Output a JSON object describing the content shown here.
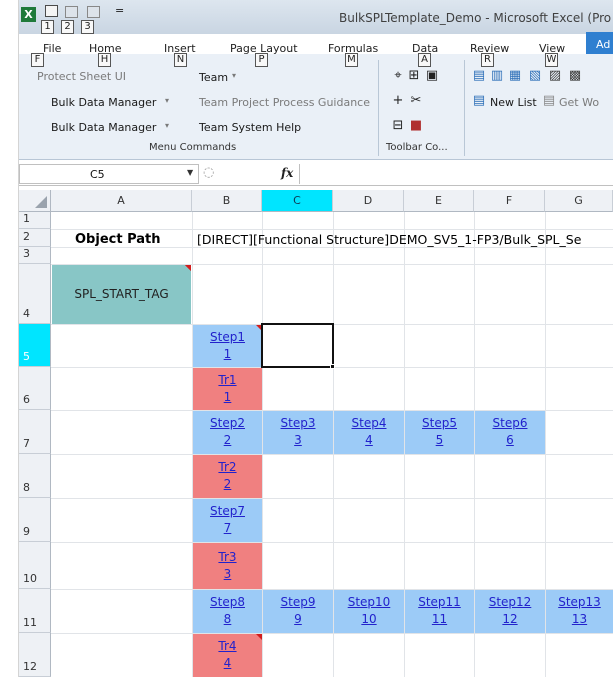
{
  "window": {
    "title": "BulkSPLTemplate_Demo  -  Microsoft Excel (Pro",
    "app_icon_glyph": "X",
    "quick_access": {
      "qat_dropdown": "="
    }
  },
  "ribbon_tabs": [
    {
      "label": "File",
      "keytip": "F"
    },
    {
      "label": "Home",
      "keytip": "H"
    },
    {
      "label": "Insert",
      "keytip": "N"
    },
    {
      "label": "Page Layout",
      "keytip": "P"
    },
    {
      "label": "Formulas",
      "keytip": "M"
    },
    {
      "label": "Data",
      "keytip": "A"
    },
    {
      "label": "Review",
      "keytip": "R"
    },
    {
      "label": "View",
      "keytip": "W"
    },
    {
      "label": "Ad",
      "keytip": ""
    }
  ],
  "quick_access_keytips": [
    "1",
    "2",
    "3"
  ],
  "ribbon": {
    "menu_commands": {
      "items_left": [
        "Protect Sheet UI",
        "Bulk Data Manager",
        "Bulk Data Manager"
      ],
      "items_right": [
        "Team",
        "Team Project Process Guidance",
        "Team System Help"
      ],
      "group_label": "Menu Commands"
    },
    "toolbar_commands": {
      "group_label": "Toolbar Co..."
    },
    "addins": {
      "new_list": "New List",
      "get_work": "Get Wo"
    }
  },
  "formula_bar": {
    "name_box": "C5",
    "fx": "fx",
    "formula": ""
  },
  "grid": {
    "columns": [
      "A",
      "B",
      "C",
      "D",
      "E",
      "F",
      "G"
    ],
    "selected_column": "C",
    "rows": [
      "1",
      "2",
      "3",
      "4",
      "5",
      "6",
      "7",
      "8",
      "9",
      "10",
      "11",
      "12"
    ],
    "selected_row": "5",
    "cells": {
      "a2": "Object Path",
      "b2": "[DIRECT][Functional Structure]DEMO_SV5_1-FP3/Bulk_SPL_Se",
      "a4": "SPL_START_TAG",
      "b5": {
        "name": "Step1",
        "id": "1"
      },
      "b6": {
        "name": "Tr1",
        "id": "1"
      },
      "b7": {
        "name": "Step2",
        "id": "2"
      },
      "c7": {
        "name": "Step3",
        "id": "3"
      },
      "d7": {
        "name": "Step4",
        "id": "4"
      },
      "e7": {
        "name": "Step5",
        "id": "5"
      },
      "f7": {
        "name": "Step6",
        "id": "6"
      },
      "b8": {
        "name": "Tr2",
        "id": "2"
      },
      "b9": {
        "name": "Step7",
        "id": "7"
      },
      "b10": {
        "name": "Tr3",
        "id": "3"
      },
      "b11": {
        "name": "Step8",
        "id": "8"
      },
      "c11": {
        "name": "Step9",
        "id": "9"
      },
      "d11": {
        "name": "Step10",
        "id": "10"
      },
      "e11": {
        "name": "Step11",
        "id": "11"
      },
      "f11": {
        "name": "Step12",
        "id": "12"
      },
      "g11": {
        "name": "Step13",
        "id": "13"
      },
      "b12": {
        "name": "Tr4",
        "id": "4"
      }
    }
  },
  "colors": {
    "step_fill": "#9ccbf7",
    "transition_fill": "#f08080",
    "start_tag_fill": "#88c6c6",
    "selection_header": "#00e5ff"
  }
}
